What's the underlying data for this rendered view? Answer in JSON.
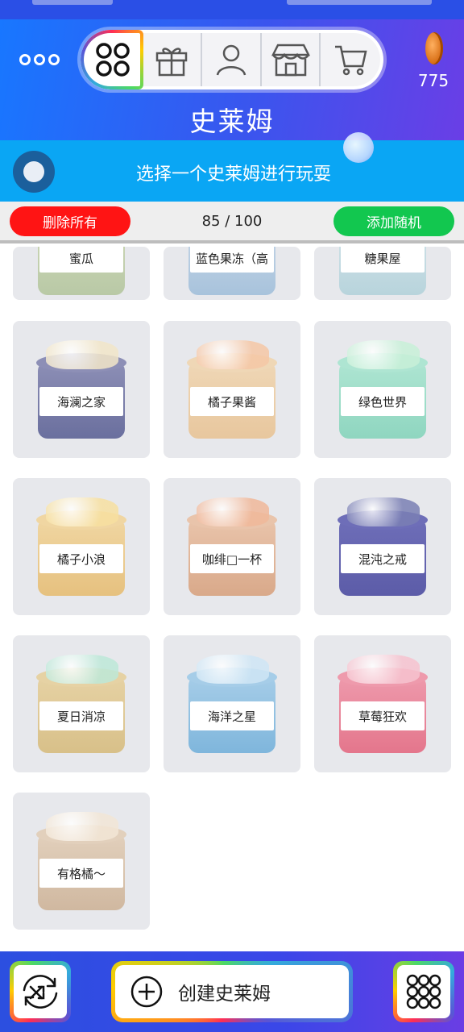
{
  "header": {
    "title": "史莱姆",
    "coins": "775",
    "tabs": [
      {
        "name": "grid",
        "icon": "grid-icon",
        "active": true
      },
      {
        "name": "gift",
        "icon": "gift-icon",
        "active": false
      },
      {
        "name": "profile",
        "icon": "user-icon",
        "active": false
      },
      {
        "name": "store",
        "icon": "store-icon",
        "active": false
      },
      {
        "name": "cart",
        "icon": "cart-icon",
        "active": false
      }
    ]
  },
  "instruction": {
    "text": "选择一个史莱姆进行玩耍"
  },
  "actions": {
    "delete_all": "删除所有",
    "counter": "85 / 100",
    "add_random": "添加随机"
  },
  "slimes_partial": [
    {
      "label": "蜜瓜",
      "body": "#b9c9a6",
      "lid": "#cfd8b8"
    },
    {
      "label": "蓝色果冻（高",
      "body": "#a8c3dc",
      "lid": "#c9d8e8"
    },
    {
      "label": "糖果屋",
      "body": "#b8d4dc",
      "lid": "#d4e4ea"
    }
  ],
  "slimes": [
    {
      "label": "海澜之家",
      "body": "#6a6f9e",
      "lid": "#8d8fb6",
      "top": "#f2e6c8"
    },
    {
      "label": "橘子果酱",
      "body": "#e8c79e",
      "lid": "#efd7b6",
      "top": "#f5c7a6"
    },
    {
      "label": "绿色世界",
      "body": "#8fd6c0",
      "lid": "#aee5d2",
      "top": "#c8f0d8"
    },
    {
      "label": "橘子小浪",
      "body": "#e6c17f",
      "lid": "#f0d6a2",
      "top": "#f7e0a0"
    },
    {
      "label": "咖绯□一杯",
      "body": "#d9a98a",
      "lid": "#e9c4ab",
      "top": "#f0b89a"
    },
    {
      "label": "混沌之戒",
      "body": "#5c5ca8",
      "lid": "#6e6eb8",
      "top": "#7a7fb4"
    },
    {
      "label": "夏日消凉",
      "body": "#d8c089",
      "lid": "#e6d2a4",
      "top": "#bde8d8"
    },
    {
      "label": "海洋之星",
      "body": "#7fb6dc",
      "lid": "#a6cde8",
      "top": "#cfe6f5"
    },
    {
      "label": "草莓狂欢",
      "body": "#e4768c",
      "lid": "#ee9aac",
      "top": "#f6c3cf"
    },
    {
      "label": "有格橘～",
      "body": "#d0b8a0",
      "lid": "#e2d0bc",
      "top": "#f2e6d6"
    }
  ],
  "bottom": {
    "create_label": "创建史莱姆"
  }
}
